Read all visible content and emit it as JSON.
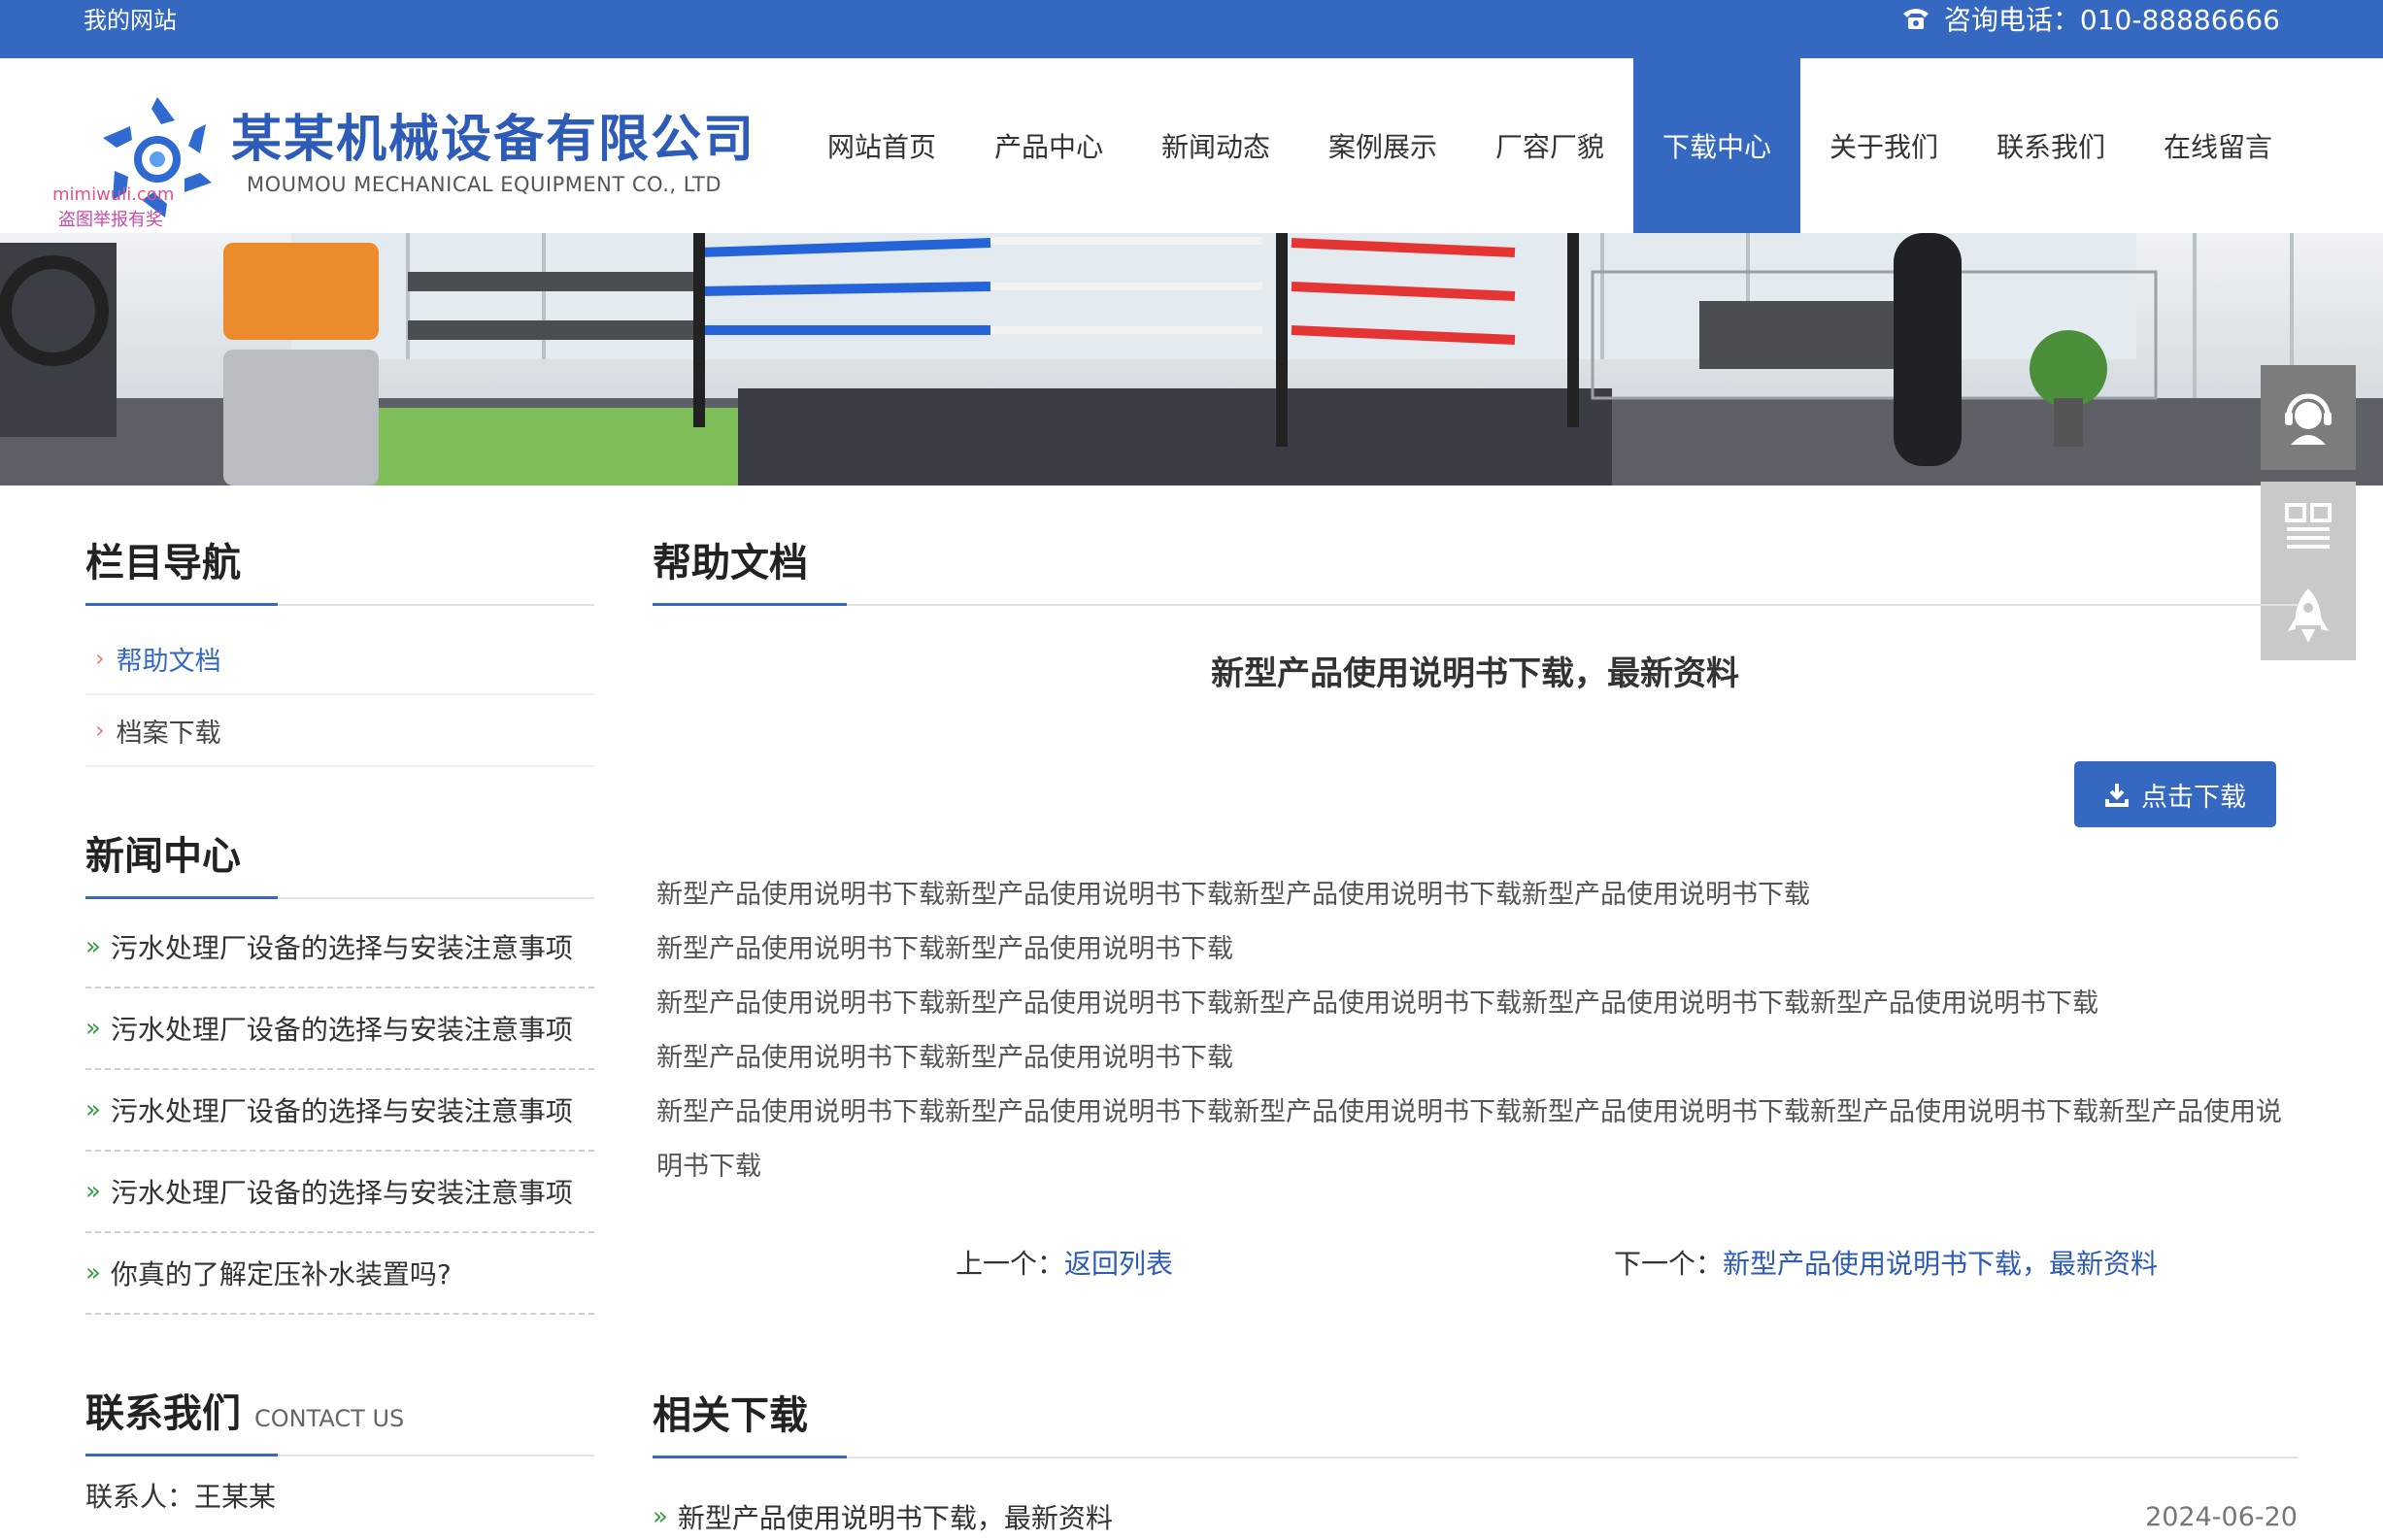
{
  "topbar": {
    "site_name": "我的网站",
    "phone_label": "咨询电话：010-88886666"
  },
  "header": {
    "company_name": "某某机械设备有限公司",
    "company_en": "MOUMOU MECHANICAL EQUIPMENT CO., LTD",
    "watermark_1": "mimiwuli.com",
    "watermark_2": "盗图举报有奖"
  },
  "nav": {
    "items": [
      "网站首页",
      "产品中心",
      "新闻动态",
      "案例展示",
      "厂容厂貌",
      "下载中心",
      "关于我们",
      "联系我们",
      "在线留言"
    ],
    "active": "下载中心"
  },
  "sidebar": {
    "category_title": "栏目导航",
    "categories": [
      "帮助文档",
      "档案下载"
    ],
    "active_category": "帮助文档",
    "news_title": "新闻中心",
    "news": [
      "污水处理厂设备的选择与安装注意事项",
      "污水处理厂设备的选择与安装注意事项",
      "污水处理厂设备的选择与安装注意事项",
      "污水处理厂设备的选择与安装注意事项",
      "你真的了解定压补水装置吗?"
    ],
    "contact_title": "联系我们",
    "contact_title_en": "CONTACT US",
    "contact_first_line": "联系人：王某某"
  },
  "main": {
    "section_title": "帮助文档",
    "doc_title": "新型产品使用说明书下载，最新资料",
    "download_button": "点击下载",
    "body_lines": [
      "新型产品使用说明书下载新型产品使用说明书下载新型产品使用说明书下载新型产品使用说明书下载",
      "新型产品使用说明书下载新型产品使用说明书下载",
      "新型产品使用说明书下载新型产品使用说明书下载新型产品使用说明书下载新型产品使用说明书下载新型产品使用说明书下载",
      "新型产品使用说明书下载新型产品使用说明书下载",
      "新型产品使用说明书下载新型产品使用说明书下载新型产品使用说明书下载新型产品使用说明书下载新型产品使用说明书下载新型产品使用说明书下载"
    ],
    "prev_label": "上一个：",
    "prev_link": "返回列表",
    "next_label": "下一个：",
    "next_link": "新型产品使用说明书下载，最新资料",
    "related_title": "相关下载",
    "related": [
      {
        "title": "新型产品使用说明书下载，最新资料",
        "date": "2024-06-20"
      }
    ]
  },
  "colors": {
    "brand_blue": "#3568c1",
    "accent_green": "#3a9a4a",
    "arrow_red": "#f07a7a"
  },
  "icons": [
    "phone-icon",
    "logo-mark-icon",
    "customer-service-icon",
    "qrcode-icon",
    "rocket-top-icon",
    "download-icon"
  ]
}
